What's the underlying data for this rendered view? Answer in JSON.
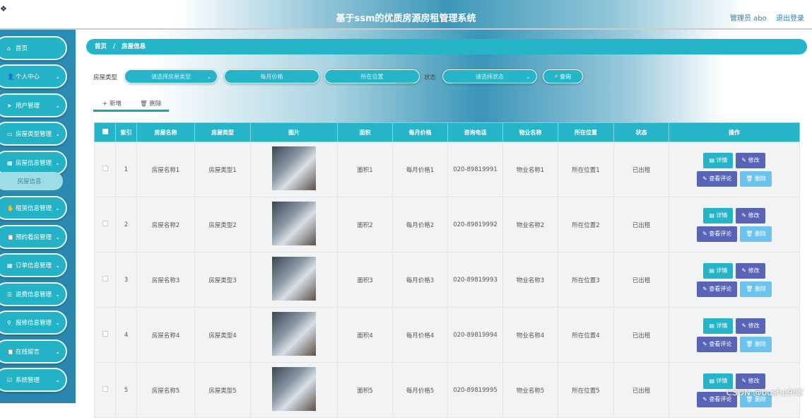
{
  "header": {
    "title": "基于ssm的优质房源房租管理系统",
    "user": "管理员 abo",
    "logout": "退出登录"
  },
  "sidebar": {
    "items": [
      {
        "label": "首页",
        "icon": "home-icon"
      },
      {
        "label": "个人中心",
        "icon": "user-icon"
      },
      {
        "label": "用户管理",
        "icon": "send-icon"
      },
      {
        "label": "房屋类型管理",
        "icon": "monitor-icon"
      },
      {
        "label": "房屋信息管理",
        "icon": "grid-icon"
      },
      {
        "label": "租赁信息管理",
        "icon": "hand-icon"
      },
      {
        "label": "预约看房管理",
        "icon": "clipboard-icon"
      },
      {
        "label": "订单信息管理",
        "icon": "grid-icon"
      },
      {
        "label": "退费信息管理",
        "icon": "list-icon"
      },
      {
        "label": "报修信息管理",
        "icon": "person-icon"
      },
      {
        "label": "在线留言",
        "icon": "clipboard-icon"
      },
      {
        "label": "系统管理",
        "icon": "check-icon"
      }
    ],
    "sub_item": "房屋信息"
  },
  "breadcrumb": {
    "home": "首页",
    "sep": "/",
    "current": "房屋信息"
  },
  "search": {
    "type_label": "房屋类型",
    "type_placeholder": "请选择房屋类型",
    "price_placeholder": "每月价格",
    "location_placeholder": "所在位置",
    "status_label": "状态",
    "status_placeholder": "请选择状态",
    "query": "查询"
  },
  "toolbar": {
    "add": "+ 新增",
    "delete": "删除"
  },
  "table": {
    "headers": [
      "索引",
      "房屋名称",
      "房屋类型",
      "图片",
      "面积",
      "每月价格",
      "咨询电话",
      "物业名称",
      "所在位置",
      "状态",
      "操作"
    ],
    "rows": [
      [
        "1",
        "房屋名称1",
        "房屋类型1",
        "面积1",
        "每月价格1",
        "020-89819991",
        "物业名称1",
        "所在位置1",
        "已出租"
      ],
      [
        "2",
        "房屋名称2",
        "房屋类型2",
        "面积2",
        "每月价格2",
        "020-89819992",
        "物业名称2",
        "所在位置2",
        "已出租"
      ],
      [
        "3",
        "房屋名称3",
        "房屋类型3",
        "面积3",
        "每月价格3",
        "020-89819993",
        "物业名称3",
        "所在位置3",
        "已出租"
      ],
      [
        "4",
        "房屋名称4",
        "房屋类型4",
        "面积4",
        "每月价格4",
        "020-89819994",
        "物业名称4",
        "所在位置4",
        "已出租"
      ],
      [
        "5",
        "房屋名称5",
        "房屋类型5",
        "面积5",
        "每月价格5",
        "020-89819995",
        "物业名称5",
        "所在位置5",
        "已出租"
      ]
    ],
    "actions": {
      "detail": "详情",
      "edit": "修改",
      "comments": "查看评论",
      "delete": "删除"
    }
  },
  "watermark": "CSDN @bushe902"
}
